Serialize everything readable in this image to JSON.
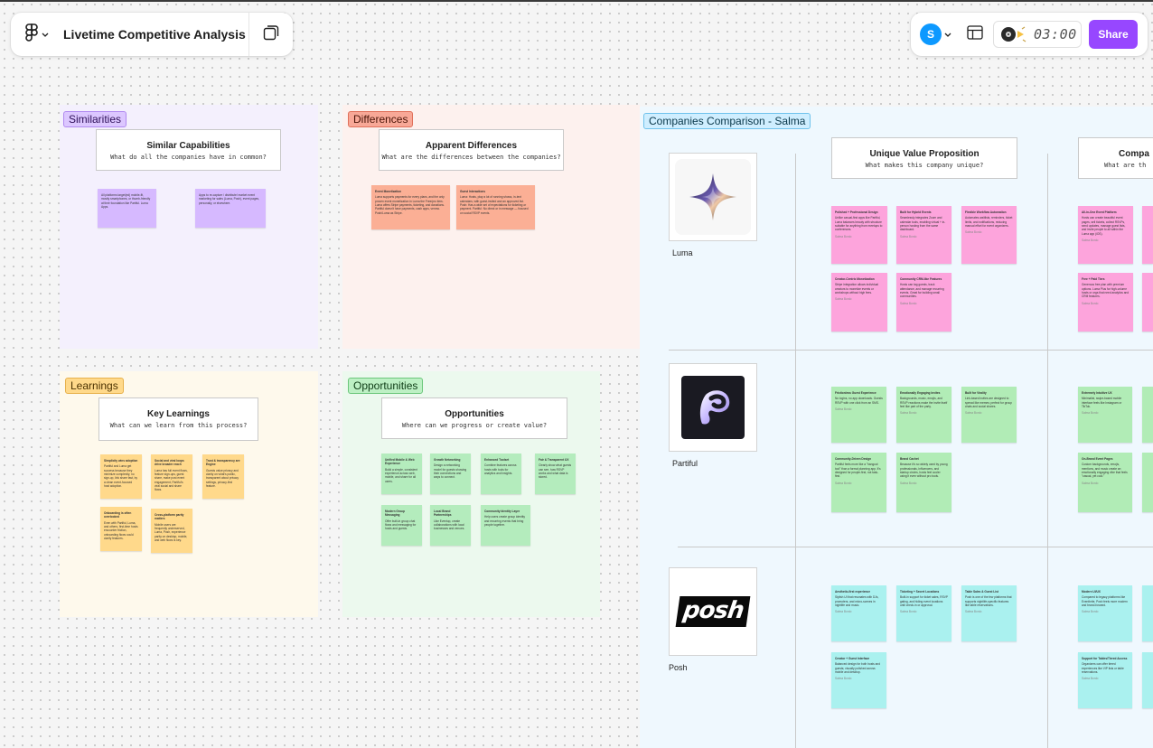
{
  "toolbar": {
    "file_title": "Livetime Competitive Analysis",
    "avatar_initial": "S",
    "timer": "03:00",
    "share_label": "Share"
  },
  "sections": {
    "similarities": {
      "label": "Similarities",
      "title": "Similar Capabilities",
      "subtitle": "What do all the companies have in common?",
      "stickies": [
        {
          "body": "All platforms target(ed) mobile-fit, mostly smartphones, or thumb-friendly at their foundation like Partiful. Luma Apps."
        },
        {
          "body": "Apps to re-capture / distribute/ market event marketing for sales (Luma, Posh), event pages, personally, or elsewhere."
        }
      ]
    },
    "differences": {
      "label": "Differences",
      "title": "Apparent Differences",
      "subtitle": "What are the differences between the companies?",
      "stickies": [
        {
          "title": "Event Monetization",
          "body": "Luma supports payments for every plans, and the only proven event monetization in Luma the Free/pro tiers. Luma offers Stripe payments, ticketing, and donations. Partiful doesn't have payments, cash apps, venmo. Posh/Luma as Stripe."
        },
        {
          "title": "Guest Interactions",
          "body": "Luma: Hosts, play a lot of running shows, in-text calendars, with guest-invited and an approved list. Posh: Has a wide set of expectations for ticketing or payment. Partiful: No direct or in message — focused on social RSVP events."
        }
      ]
    },
    "learnings": {
      "label": "Learnings",
      "title": "Key Learnings",
      "subtitle": "What can we learn from this process?",
      "stickies": [
        {
          "title": "Simplicity wins adoption",
          "body": "Partiful and Luma get success because they minimize complexity, no sign-up, link share fast, by a clean event-focused host adoption."
        },
        {
          "title": "Social and viral loops drive broader reach",
          "body": "Luma has full event flows, feature sign-ups, guest share, make post event engagement, Partiful's viral social and share flows."
        },
        {
          "title": "Trust & transparency are Engine",
          "body": "Guests value privacy and clarity on what's public, transparent about privacy settings, privacy-first feature."
        },
        {
          "title": "Onboarding is often overlooked",
          "body": "Even with Partiful, Luma, and others, first-time hosts encounter friction, onboarding flows could clarify features."
        },
        {
          "title": "Cross-platform parity matters",
          "body": "Mobile users are frequently underserved, Luma, Posh, experience parity on desktop, mobile, and web flows is key."
        }
      ]
    },
    "opportunities": {
      "label": "Opportunities",
      "title": "Opportunities",
      "subtitle": "Where can we progress or create value?",
      "stickies": [
        {
          "title": "Unified Mobile & Web Experience",
          "body": "Build a simple, consistent experience across web, mobile, and share for all users."
        },
        {
          "title": "Growth Networking",
          "body": "Design a networking model for guests showing their connections and ways to connect."
        },
        {
          "title": "Enhanced Toolset",
          "body": "Combine features across hosts with tools for analytics and insights."
        },
        {
          "title": "Fair & Transparent UX",
          "body": "Clearly show what guests can see, how RSVP works and what data is stored."
        },
        {
          "title": "Modern Group Messaging",
          "body": "Offer built-in group chat flows and messaging for hosts and guests."
        },
        {
          "title": "Local Brand Partnerships",
          "body": "Like Eventup, create collaborations with local businesses and venues."
        },
        {
          "title": "Community Identity Layer",
          "body": "Help users create group identity and recurring events that bring people together."
        }
      ]
    },
    "comparison": {
      "label": "Companies Comparison - Salma",
      "col1_title": "Unique Value Proposition",
      "col1_subtitle": "What makes this company unique?",
      "col2_title": "Compa",
      "col2_subtitle": "What are th",
      "companies": [
        {
          "name": "Luma",
          "logo_icon": "luma-star-icon",
          "uvp": [
            {
              "title": "Polished + Professional Design",
              "body": "Unlike casual-first apps like Partiful, Luma balances beauty with structure suitable for anything from meetups to conferences.",
              "author": "Salma Bordo"
            },
            {
              "title": "Built for Hybrid Events",
              "body": "Seamlessly integrates Zoom and calendar tools, enabling virtual + in-person hosting from the same dashboard.",
              "author": "Salma Bordo"
            },
            {
              "title": "Flexible Workflow Automation",
              "body": "Automates waitlists, reminders, ticket limits, and notifications, reducing manual effort for event organizers.",
              "author": "Salma Bordo"
            },
            {
              "title": "Creator-Centric Monetization",
              "body": "Stripe integration allows individual creators to monetize events or workshops without high fees.",
              "author": "Salma Bordo"
            },
            {
              "title": "Community CRM-like Features",
              "body": "Hosts can tag guests, track attendance, and manage recurring events. Great for building small communities.",
              "author": "Salma Bordo"
            }
          ],
          "comp": [
            {
              "title": "All-in-One Event Platform",
              "body": "Hosts can create beautiful event pages, sell tickets, collect RSVPs, send updates, manage guest lists, and invite people to all within the Luma app (iOS).",
              "author": "Salma Bordo"
            },
            {
              "title": "Free + Paid Tiers",
              "body": "Generous free plan with premium options. Luma Plus for high-volume hosts or orgs that need analytics and CRM features.",
              "author": "Salma Bordo"
            }
          ]
        },
        {
          "name": "Partiful",
          "logo_icon": "partiful-logo-icon",
          "uvp": [
            {
              "title": "Frictionless Guest Experience",
              "body": "No logins, no app downloads. Guests RSVP with one click from an SMS.",
              "author": "Salma Bordo"
            },
            {
              "title": "Emotionally Engaging Invites",
              "body": "Backgrounds, music, emojis, and RSVP reactions make the invite itself feel like part of the party.",
              "author": "Salma Bordo"
            },
            {
              "title": "Built for Virality",
              "body": "Link-based invites are designed to spread like memes; perfect for group chats and social shares.",
              "author": "Salma Bordo"
            },
            {
              "title": "Community-Driven Design",
              "body": "Partiful feels more like a \"hangout tool\" than a formal planning app. It's designed for people-first, not task-first.",
              "author": "Salma Bordo"
            },
            {
              "title": "Brand Cachet",
              "body": "Because it's so widely used by young professionals, influencers, and startup circles, hosts feel cooler using it even without pro tools.",
              "author": "Salma Bordo"
            }
          ],
          "comp": [
            {
              "title": "Extremely Intuitive UX",
              "body": "Minimalist, swipe-based mobile interface feels like Instagram or TikTok.",
              "author": "Salma Bordo"
            },
            {
              "title": "On-Brand Event Pages",
              "body": "Custom backgrounds, emojis, mentions, and music create an emotionally engaging vibe that feels \"casual, yet cool.\"",
              "author": "Salma Bordo"
            }
          ]
        },
        {
          "name": "Posh",
          "logo_icon": "posh-wordmark-icon",
          "logo_text": "posh",
          "uvp": [
            {
              "title": "Aesthetic-first experience",
              "body": "Stylish UI that resonates with DJs, promoters, and micro-scenes in nightlife and music.",
              "author": "Salma Bordo"
            },
            {
              "title": "Ticketing + Secret Locations",
              "body": "Built-in support for ticket sales, RSVP gating, and hiding event locations until check-in or approval.",
              "author": "Salma Bordo"
            },
            {
              "title": "Table Sales & Guest List",
              "body": "Posh is one of the few platforms that supports nightlife-specific features like table reservations.",
              "author": "Salma Bordo"
            },
            {
              "title": "Creator + Guest Interface",
              "body": "Balanced design for both hosts and guests; visually polished across mobile and desktop.",
              "author": "Salma Bordo"
            }
          ],
          "comp": [
            {
              "title": "Modern UI/UX",
              "body": "Compared to legacy platforms like Eventbrite, Posh feels more modern and brand-forward.",
              "author": "Salma Bordo"
            },
            {
              "title": "Support for Tables/Tiered Access",
              "body": "Organizers can offer tiered experiences like VIP lists or table reservations.",
              "author": "Salma Bordo"
            }
          ]
        }
      ]
    }
  },
  "colors": {
    "share_button": "#9747ff",
    "avatar": "#0d99ff",
    "similarities_bg": "#f4f0fd",
    "differences_bg": "#fdf1ee",
    "learnings_bg": "#fef9ec",
    "opportunities_bg": "#ecf9ee",
    "comparison_bg": "#eff8fe"
  }
}
